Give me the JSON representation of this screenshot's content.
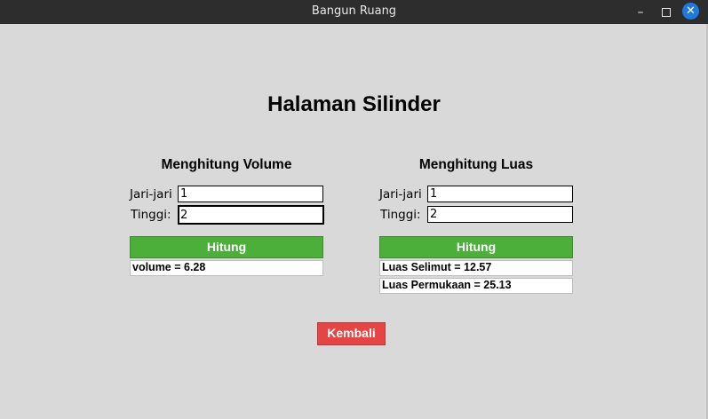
{
  "window": {
    "title": "Bangun Ruang",
    "minimize_glyph": "–",
    "close_glyph": "✕"
  },
  "page": {
    "title": "Halaman Silinder"
  },
  "volume": {
    "heading": "Menghitung Volume",
    "radius_label": "Jari-jari",
    "radius_value": "1",
    "height_label": "Tinggi:",
    "height_value": "2",
    "button_label": "Hitung",
    "result": "volume = 6.28"
  },
  "luas": {
    "heading": "Menghitung Luas",
    "radius_label": "Jari-jari",
    "radius_value": "1",
    "height_label": "Tinggi:",
    "height_value": "2",
    "button_label": "Hitung",
    "result_selimut": "Luas Selimut = 12.57",
    "result_permukaan": "Luas Permukaan = 25.13"
  },
  "back_button": {
    "label": "Kembali"
  },
  "colors": {
    "titlebar": "#2d2d2d",
    "background": "#d9d9d9",
    "hitung_button": "#4caf3a",
    "kembali_button": "#e64545",
    "close_button": "#1f7ae0"
  },
  "icons": {
    "minimize": "minimize-icon",
    "maximize": "maximize-icon",
    "close": "close-icon"
  }
}
